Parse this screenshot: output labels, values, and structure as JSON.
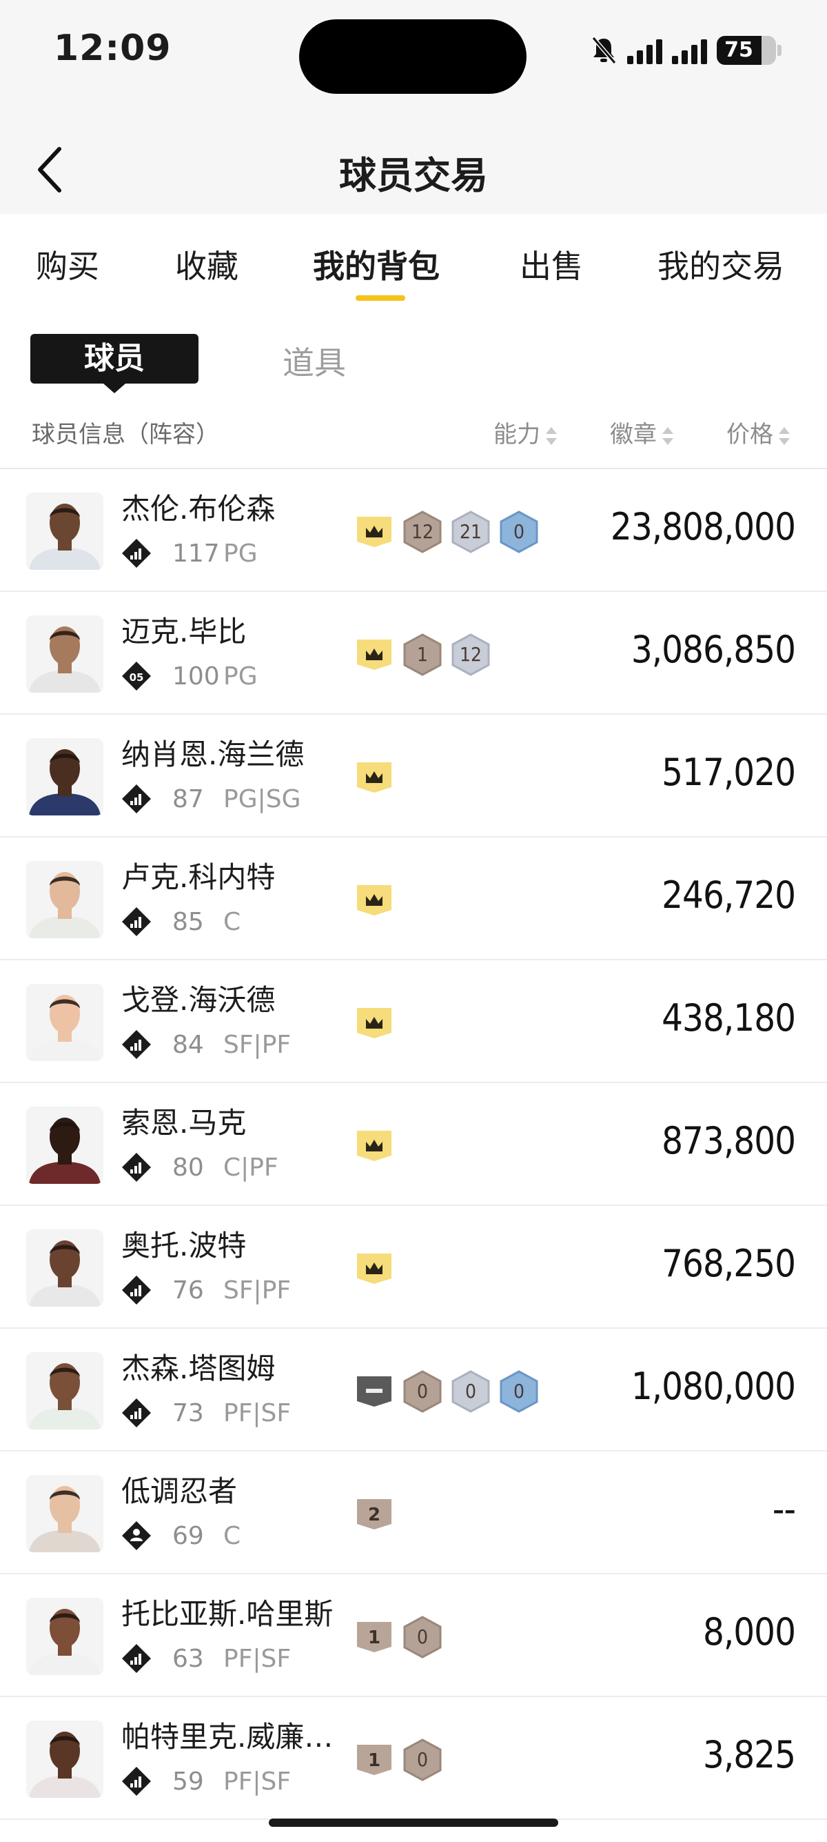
{
  "status": {
    "time": "12:09",
    "battery": "75"
  },
  "nav": {
    "title": "球员交易"
  },
  "tabs": [
    "购买",
    "收藏",
    "我的背包",
    "出售",
    "我的交易"
  ],
  "subtabs": {
    "active": "球员",
    "other": "道具"
  },
  "header": {
    "info": "球员信息（阵容）",
    "ability": "能力",
    "badge": "徽章",
    "price": "价格"
  },
  "colors": {
    "accent": "#f6c21a",
    "crown_bg": "#f6dc7a",
    "badge_bronze": "#b5a296",
    "badge_silver": "#c2c8d4",
    "badge_blue": "#8db4db"
  },
  "players": [
    {
      "name": "杰伦.布伦森",
      "rating": "117",
      "pos": "PG",
      "rank_icon": "signal-rank-icon",
      "badge_main": "crown",
      "badges": [
        {
          "v": "12",
          "t": "bronze"
        },
        {
          "v": "21",
          "t": "silver"
        },
        {
          "v": "0",
          "t": "blue"
        }
      ],
      "price": "23,808,000",
      "skin": "#6b4630",
      "jersey": "#dfe3ea"
    },
    {
      "name": "迈克.毕比",
      "rating": "100",
      "pos": "PG",
      "rank_icon": "rank-05-icon",
      "badge_main": "crown",
      "badges": [
        {
          "v": "1",
          "t": "bronze"
        },
        {
          "v": "12",
          "t": "silver"
        }
      ],
      "price": "3,086,850",
      "skin": "#a67a5c",
      "jersey": "#e6e6e6"
    },
    {
      "name": "纳肖恩.海兰德",
      "rating": "87",
      "pos": "PG|SG",
      "rank_icon": "signal-rank-icon",
      "badge_main": "crown",
      "badges": [],
      "price": "517,020",
      "skin": "#4a2e20",
      "jersey": "#2b3a6b"
    },
    {
      "name": "卢克.科内特",
      "rating": "85",
      "pos": "C",
      "rank_icon": "signal-rank-icon",
      "badge_main": "crown",
      "badges": [],
      "price": "246,720",
      "skin": "#e2b99a",
      "jersey": "#e9ece6"
    },
    {
      "name": "戈登.海沃德",
      "rating": "84",
      "pos": "SF|PF",
      "rank_icon": "signal-rank-icon",
      "badge_main": "crown",
      "badges": [],
      "price": "438,180",
      "skin": "#eec3a5",
      "jersey": "#f2f2f2"
    },
    {
      "name": "索恩.马克",
      "rating": "80",
      "pos": "C|PF",
      "rank_icon": "signal-rank-icon",
      "badge_main": "crown",
      "badges": [],
      "price": "873,800",
      "skin": "#2c1a13",
      "jersey": "#6e2a2a"
    },
    {
      "name": "奥托.波特",
      "rating": "76",
      "pos": "SF|PF",
      "rank_icon": "signal-rank-icon",
      "badge_main": "crown",
      "badges": [],
      "price": "768,250",
      "skin": "#6a4330",
      "jersey": "#e8e8e8"
    },
    {
      "name": "杰森.塔图姆",
      "rating": "73",
      "pos": "PF|SF",
      "rank_icon": "signal-rank-icon",
      "badge_main": "minus",
      "badges": [
        {
          "v": "0",
          "t": "bronze"
        },
        {
          "v": "0",
          "t": "silver"
        },
        {
          "v": "0",
          "t": "blue"
        }
      ],
      "price": "1,080,000",
      "skin": "#7a5038",
      "jersey": "#e7efe8"
    },
    {
      "name": "低调忍者",
      "rating": "69",
      "pos": "C",
      "rank_icon": "person-rank-icon",
      "badge_main": "two",
      "badges": [],
      "price": "--",
      "skin": "#e6c0a2",
      "jersey": "#e0d8d0"
    },
    {
      "name": "托比亚斯.哈里斯",
      "rating": "63",
      "pos": "PF|SF",
      "rank_icon": "signal-rank-icon",
      "badge_main": "one",
      "badges": [
        {
          "v": "0",
          "t": "bronze"
        }
      ],
      "price": "8,000",
      "skin": "#7d4e38",
      "jersey": "#f1f1f1"
    },
    {
      "name": "帕特里克.威廉…",
      "rating": "59",
      "pos": "PF|SF",
      "rank_icon": "signal-rank-icon",
      "badge_main": "one",
      "badges": [
        {
          "v": "0",
          "t": "bronze"
        }
      ],
      "price": "3,825",
      "skin": "#5a3626",
      "jersey": "#ebe3e3"
    }
  ]
}
